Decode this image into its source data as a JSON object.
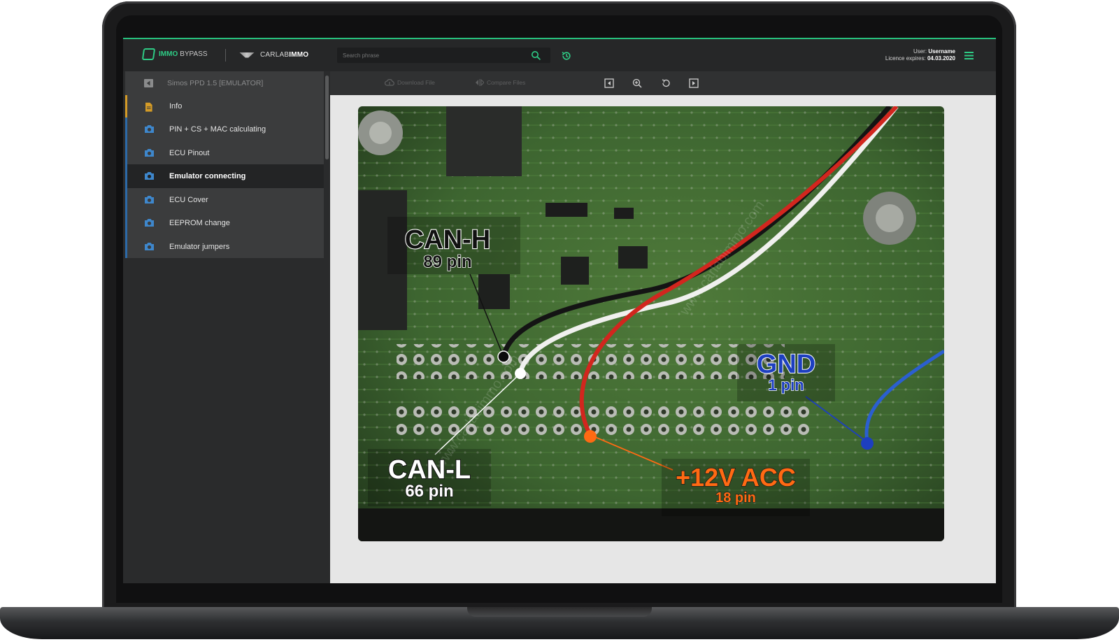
{
  "header": {
    "logo_primary": "IMMO",
    "logo_secondary": "BYPASS",
    "brand_light": "CARLAB",
    "brand_bold": "IMMO",
    "search_placeholder": "Search phrase",
    "user_label": "User:",
    "user_name": "Username",
    "licence_label": "Licence expires:",
    "licence_date": "04.03.2020"
  },
  "sidebar": {
    "title": "Simos PPD 1.5 [EMULATOR]",
    "items": [
      {
        "label": "Info",
        "icon": "document-icon"
      },
      {
        "label": "PIN + CS + MAC calculating",
        "icon": "camera-icon"
      },
      {
        "label": "ECU Pinout",
        "icon": "camera-icon"
      },
      {
        "label": "Emulator connecting",
        "icon": "camera-icon",
        "active": true
      },
      {
        "label": "ECU Cover",
        "icon": "camera-icon"
      },
      {
        "label": "EEPROM change",
        "icon": "camera-icon"
      },
      {
        "label": "Emulator jumpers",
        "icon": "camera-icon"
      }
    ]
  },
  "toolbar": {
    "download_label": "Download File",
    "compare_label": "Compare Files"
  },
  "photo": {
    "watermark": "www.carlabimmo.com",
    "labels": {
      "canh_name": "CAN-H",
      "canh_pin": "89 pin",
      "canl_name": "CAN-L",
      "canl_pin": "66 pin",
      "gnd_name": "GND",
      "gnd_pin": "1 pin",
      "acc_name": "+12V ACC",
      "acc_pin": "18 pin"
    }
  },
  "colors": {
    "accent": "#2ecb85",
    "info_bar": "#d49b27",
    "item_bar": "#2c6aa8",
    "acc_label": "#ff6a13",
    "gnd_label": "#1d3fbf"
  }
}
